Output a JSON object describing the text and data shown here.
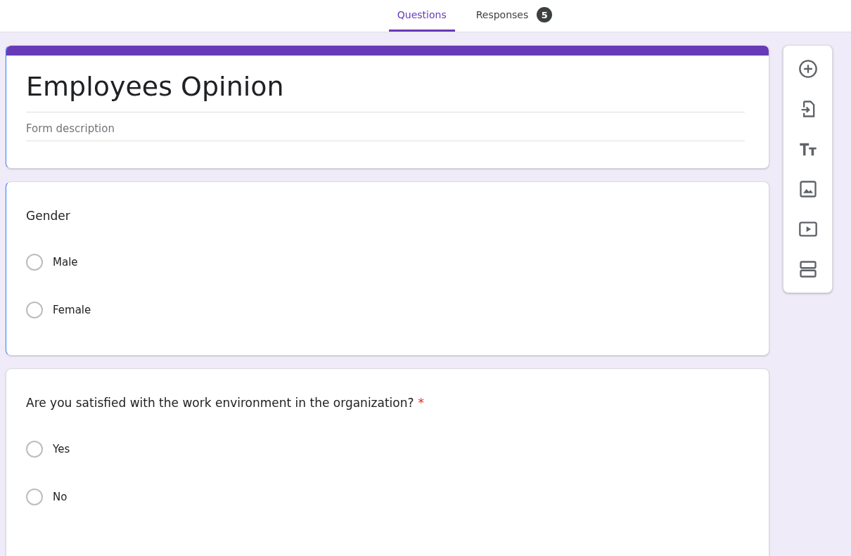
{
  "tabs": [
    {
      "label": "Questions",
      "selected": true
    },
    {
      "label": "Responses",
      "selected": false,
      "badge": "5"
    }
  ],
  "form": {
    "title": "Employees Opinion",
    "description_placeholder": "Form description",
    "highlighted": true
  },
  "questions": [
    {
      "title": "Gender",
      "highlighted": true,
      "options": [
        {
          "label": "Male",
          "selected": false
        },
        {
          "label": "Female",
          "selected": false
        }
      ]
    },
    {
      "title": "Are you satisfied with the work environment in the organization?",
      "required_mark": "*",
      "highlighted": false,
      "options": [
        {
          "label": "Yes",
          "selected": false
        },
        {
          "label": "No",
          "selected": false
        }
      ]
    }
  ],
  "toolbar": [
    {
      "kind": "add"
    },
    {
      "kind": "import"
    },
    {
      "kind": "text"
    },
    {
      "kind": "image"
    },
    {
      "kind": "video"
    },
    {
      "kind": "section"
    }
  ]
}
